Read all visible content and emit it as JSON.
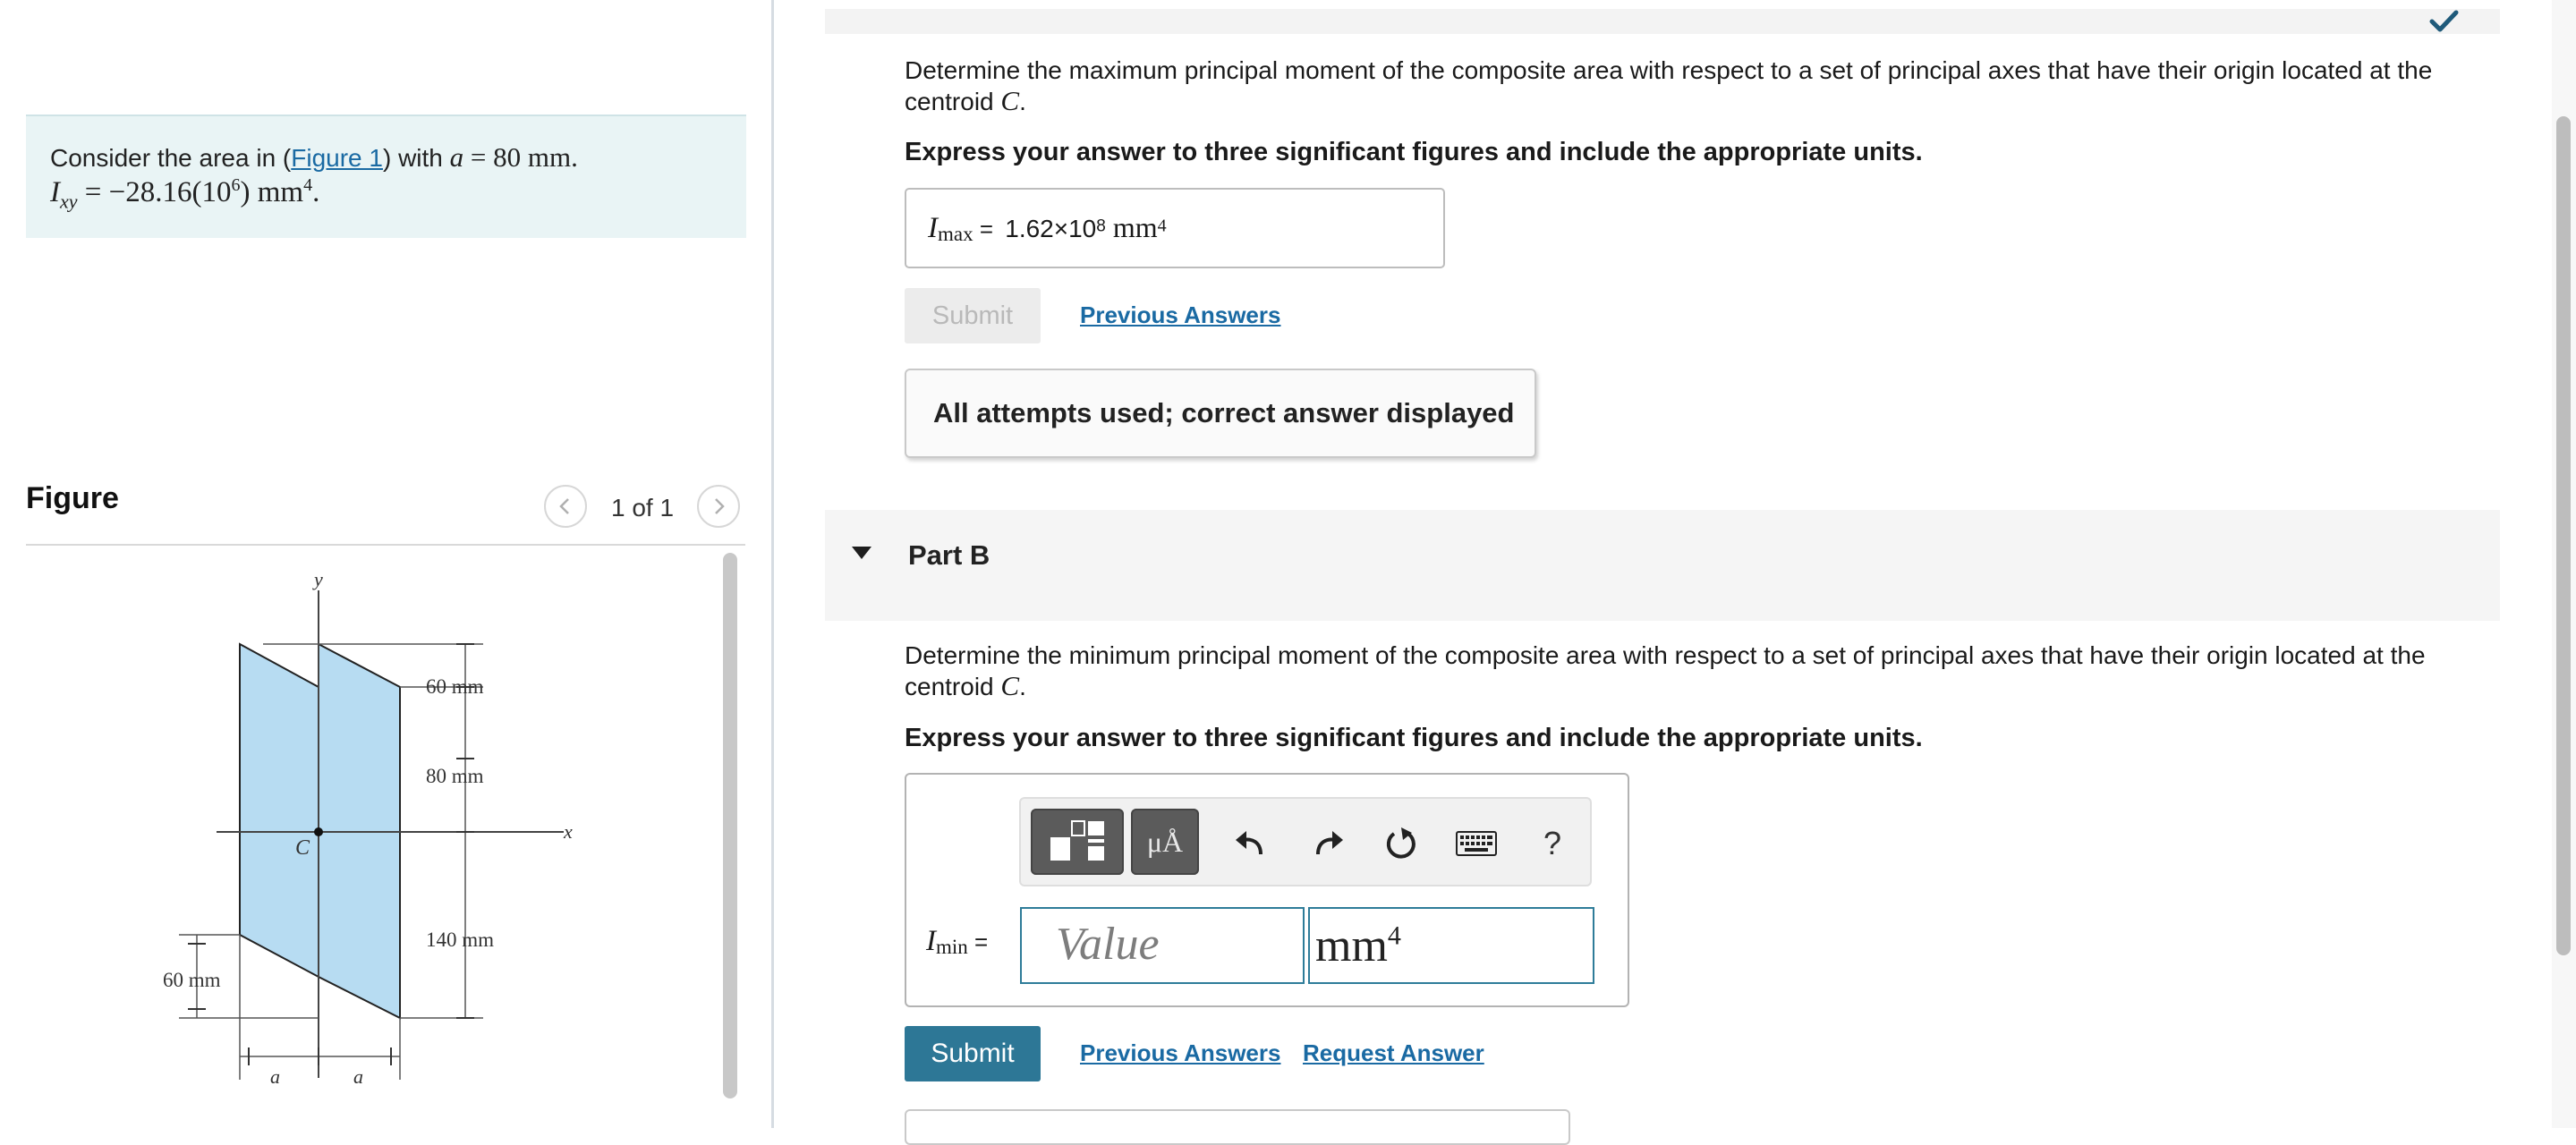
{
  "problem": {
    "prefix": "Consider the area in (",
    "figure_link": "Figure 1",
    "mid": ") with ",
    "a_symbol": "a",
    "a_value": " = 80 mm.",
    "ixy_label": "I",
    "ixy_sub": "xy",
    "ixy_value": " = −28.16(10",
    "ixy_exp": "6",
    "ixy_unit": ") mm",
    "ixy_unit_exp": "4",
    "ixy_end": "."
  },
  "figure": {
    "title": "Figure",
    "pager": "1 of 1",
    "prev_icon": "chevron-left-icon",
    "next_icon": "chevron-right-icon",
    "labels": {
      "y_axis": "y",
      "x_axis": "x",
      "centroid": "C",
      "dim_top": "60 mm",
      "dim_mid": "80 mm",
      "dim_low": "140 mm",
      "dim_left": "60 mm",
      "a_left": "a",
      "a_right": "a"
    },
    "fill_color": "#b7dcf2"
  },
  "part_a": {
    "question_start": "Determine the maximum principal moment of the composite area with respect to a set of principal axes that have their origin located at the",
    "question_end": "centroid ",
    "centroid_symbol": "C",
    "question_tail": ".",
    "instruction": "Express your answer to three significant figures and include the appropriate units.",
    "answer_var": "I",
    "answer_sub": "max",
    "answer_eq": " = ",
    "answer_value": "1.62×10",
    "answer_exp": "8",
    "answer_unit": " mm",
    "answer_unit_exp": "4",
    "submit_label": "Submit",
    "previous_answers": "Previous Answers",
    "attempts_msg": "All attempts used; correct answer displayed",
    "check_icon": "checkmark-icon",
    "check_color": "#1f5a7a"
  },
  "part_b": {
    "header": "Part B",
    "collapse_icon": "caret-down-icon",
    "question_start": "Determine the minimum principal moment of the composite area with respect to a set of principal axes that have their origin located at the",
    "question_end": "centroid ",
    "centroid_symbol": "C",
    "question_tail": ".",
    "instruction": "Express your answer to three significant figures and include the appropriate units.",
    "toolbar": {
      "templates_icon": "templates-icon",
      "units_label": "μÅ",
      "undo_icon": "undo-icon",
      "redo_icon": "redo-icon",
      "reset_icon": "reset-icon",
      "keyboard_icon": "keyboard-icon",
      "help_label": "?"
    },
    "answer_var": "I",
    "answer_sub": "min",
    "answer_eq": " =",
    "value_placeholder": "Value",
    "unit_value": "mm",
    "unit_exp": "4",
    "submit_label": "Submit",
    "previous_answers": "Previous Answers",
    "request_answer": "Request Answer",
    "accent_color": "#2d7796"
  }
}
